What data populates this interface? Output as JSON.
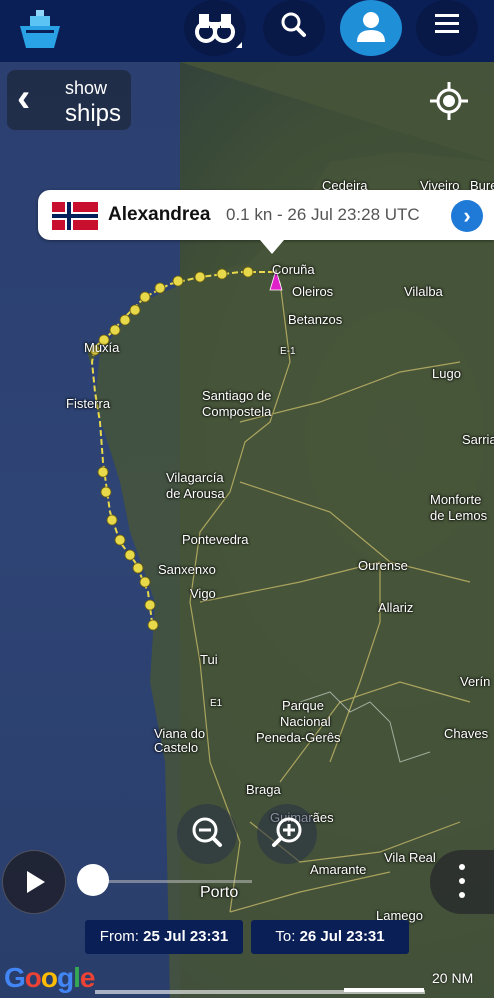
{
  "header": {
    "logo_icon": "ship-logo-icon",
    "binoculars_icon": "binoculars-icon",
    "search_icon": "search-icon",
    "user_icon": "user-icon",
    "menu_icon": "hamburger-menu-icon"
  },
  "map_controls": {
    "show_label_line1": "show",
    "show_label_line2": "ships",
    "locate_icon": "crosshair-locate-icon",
    "zoom_out_icon": "zoom-out-icon",
    "zoom_in_icon": "zoom-in-icon"
  },
  "vessel_popup": {
    "flag": "Norway",
    "name": "Alexandrea",
    "info": "0.1 kn - 26 Jul 23:28 UTC"
  },
  "map_labels": [
    "Cedeira",
    "Viveiro",
    "Bure",
    "Coruña",
    "Oleiros",
    "Vilalba",
    "Betanzos",
    "Muxía",
    "Fisterra",
    "Santiago de",
    "Compostela",
    "Lugo",
    "Sarria",
    "Vilagarcía",
    "de Arousa",
    "Monforte",
    "de Lemos",
    "Pontevedra",
    "Sanxenxo",
    "Ourense",
    "Vigo",
    "Allariz",
    "Tui",
    "Verín",
    "Parque",
    "Nacional",
    "Peneda-Gerês",
    "Viana do",
    "Castelo",
    "Chaves",
    "Braga",
    "Guimarães",
    "Vila Real",
    "Amarante",
    "Porto",
    "Lamego",
    "E-1",
    "E1"
  ],
  "playback": {
    "from_label": "From:",
    "from_value": "25 Jul 23:31",
    "to_label": "To:",
    "to_value": "26 Jul 23:31",
    "progress": 0.0
  },
  "footer": {
    "google_logo": "Google",
    "scale_label": "20 NM"
  },
  "colors": {
    "header_bg": "#0b1f57",
    "active_user_button": "#1f8fd8",
    "track_color": "#e8d94a",
    "ship_marker": "#e020c8"
  }
}
